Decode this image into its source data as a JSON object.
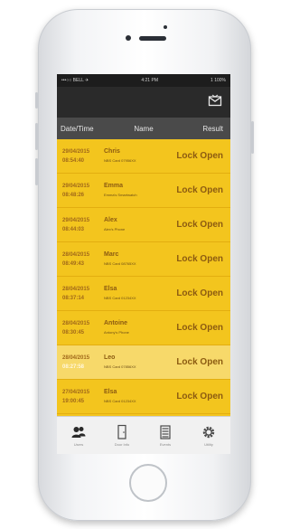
{
  "status_bar": {
    "carrier": "•••○○ BELL ✈",
    "time": "4:21 PM",
    "battery": "1 100%"
  },
  "table_headers": {
    "date": "Date/Time",
    "name": "Name",
    "result": "Result"
  },
  "rows": [
    {
      "date": "29/04/2015",
      "time": "08:54:40",
      "name": "Chris",
      "sub": "NBS Card 07956XX",
      "result": "Lock Open",
      "highlight": false
    },
    {
      "date": "29/04/2015",
      "time": "08:48:26",
      "name": "Emma",
      "sub": "Emma's Smartwatch",
      "result": "Lock Open",
      "highlight": false
    },
    {
      "date": "29/04/2015",
      "time": "08:44:03",
      "name": "Alex",
      "sub": "Alex's Phone",
      "result": "Lock Open",
      "highlight": false
    },
    {
      "date": "28/04/2015",
      "time": "08:49:43",
      "name": "Marc",
      "sub": "NBS Card 08765XX",
      "result": "Lock Open",
      "highlight": false
    },
    {
      "date": "28/04/2015",
      "time": "08:37:14",
      "name": "Elsa",
      "sub": "NBS Card 01234XX",
      "result": "Lock Open",
      "highlight": false
    },
    {
      "date": "28/04/2015",
      "time": "08:30:45",
      "name": "Antoine",
      "sub": "Antony's Phone",
      "result": "Lock Open",
      "highlight": false
    },
    {
      "date": "28/04/2015",
      "time": "08:27:58",
      "name": "Leo",
      "sub": "NBS Card 07856XX",
      "result": "Lock Open",
      "highlight": true
    },
    {
      "date": "27/04/2015",
      "time": "19:00:45",
      "name": "Elsa",
      "sub": "NBS Card 01234XX",
      "result": "Lock Open",
      "highlight": false
    }
  ],
  "tabs": [
    {
      "label": "Users",
      "icon": "users-icon"
    },
    {
      "label": "Door Info",
      "icon": "door-icon"
    },
    {
      "label": "Events",
      "icon": "events-icon"
    },
    {
      "label": "Utility",
      "icon": "gear-icon"
    }
  ],
  "colors": {
    "primary": "#f3c51e",
    "header_dark": "#2a2a2a",
    "column_header": "#4a4a4a",
    "text_brown": "#8c5b11"
  }
}
